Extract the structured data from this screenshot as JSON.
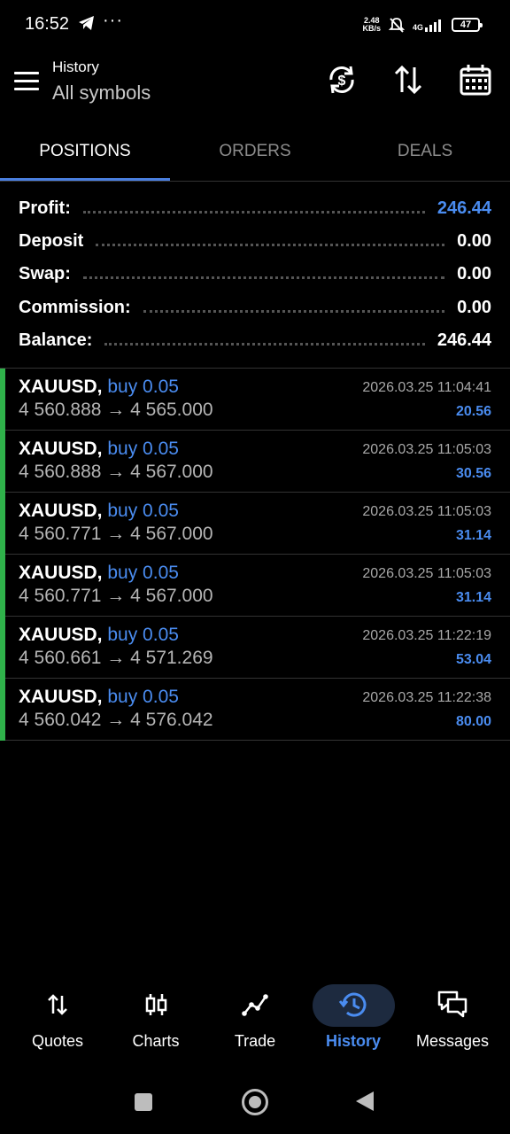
{
  "status_bar": {
    "time": "16:52",
    "dots": "···",
    "net_speed_value": "2.48",
    "net_speed_unit": "KB/s",
    "network_gen": "4G",
    "battery": "47"
  },
  "header": {
    "title": "History",
    "subtitle": "All symbols"
  },
  "tabs": [
    {
      "label": "POSITIONS",
      "active": true
    },
    {
      "label": "ORDERS",
      "active": false
    },
    {
      "label": "DEALS",
      "active": false
    }
  ],
  "summary": [
    {
      "label": "Profit:",
      "value": "246.44",
      "highlight": true
    },
    {
      "label": "Deposit",
      "value": "0.00",
      "highlight": false
    },
    {
      "label": "Swap:",
      "value": "0.00",
      "highlight": false
    },
    {
      "label": "Commission:",
      "value": "0.00",
      "highlight": false
    },
    {
      "label": "Balance:",
      "value": "246.44",
      "highlight": false
    }
  ],
  "positions": [
    {
      "symbol": "XAUUSD,",
      "direction": "buy 0.05",
      "open_price": "4 560.888",
      "arrow": "→",
      "close_price": "4 565.000",
      "time": "2026.03.25 11:04:41",
      "profit": "20.56"
    },
    {
      "symbol": "XAUUSD,",
      "direction": "buy 0.05",
      "open_price": "4 560.888",
      "arrow": "→",
      "close_price": "4 567.000",
      "time": "2026.03.25 11:05:03",
      "profit": "30.56"
    },
    {
      "symbol": "XAUUSD,",
      "direction": "buy 0.05",
      "open_price": "4 560.771",
      "arrow": "→",
      "close_price": "4 567.000",
      "time": "2026.03.25 11:05:03",
      "profit": "31.14"
    },
    {
      "symbol": "XAUUSD,",
      "direction": "buy 0.05",
      "open_price": "4 560.771",
      "arrow": "→",
      "close_price": "4 567.000",
      "time": "2026.03.25 11:05:03",
      "profit": "31.14"
    },
    {
      "symbol": "XAUUSD,",
      "direction": "buy 0.05",
      "open_price": "4 560.661",
      "arrow": "→",
      "close_price": "4 571.269",
      "time": "2026.03.25 11:22:19",
      "profit": "53.04"
    },
    {
      "symbol": "XAUUSD,",
      "direction": "buy 0.05",
      "open_price": "4 560.042",
      "arrow": "→",
      "close_price": "4 576.042",
      "time": "2026.03.25 11:22:38",
      "profit": "80.00"
    }
  ],
  "bottom_nav": [
    {
      "label": "Quotes",
      "icon": "quotes-icon",
      "active": false
    },
    {
      "label": "Charts",
      "icon": "candles-icon",
      "active": false
    },
    {
      "label": "Trade",
      "icon": "trade-icon",
      "active": false
    },
    {
      "label": "History",
      "icon": "history-icon",
      "active": true
    },
    {
      "label": "Messages",
      "icon": "messages-icon",
      "active": false
    }
  ],
  "colors": {
    "accent": "#4a8cf0",
    "buy_bar": "#2fb14a",
    "background": "#000000"
  }
}
